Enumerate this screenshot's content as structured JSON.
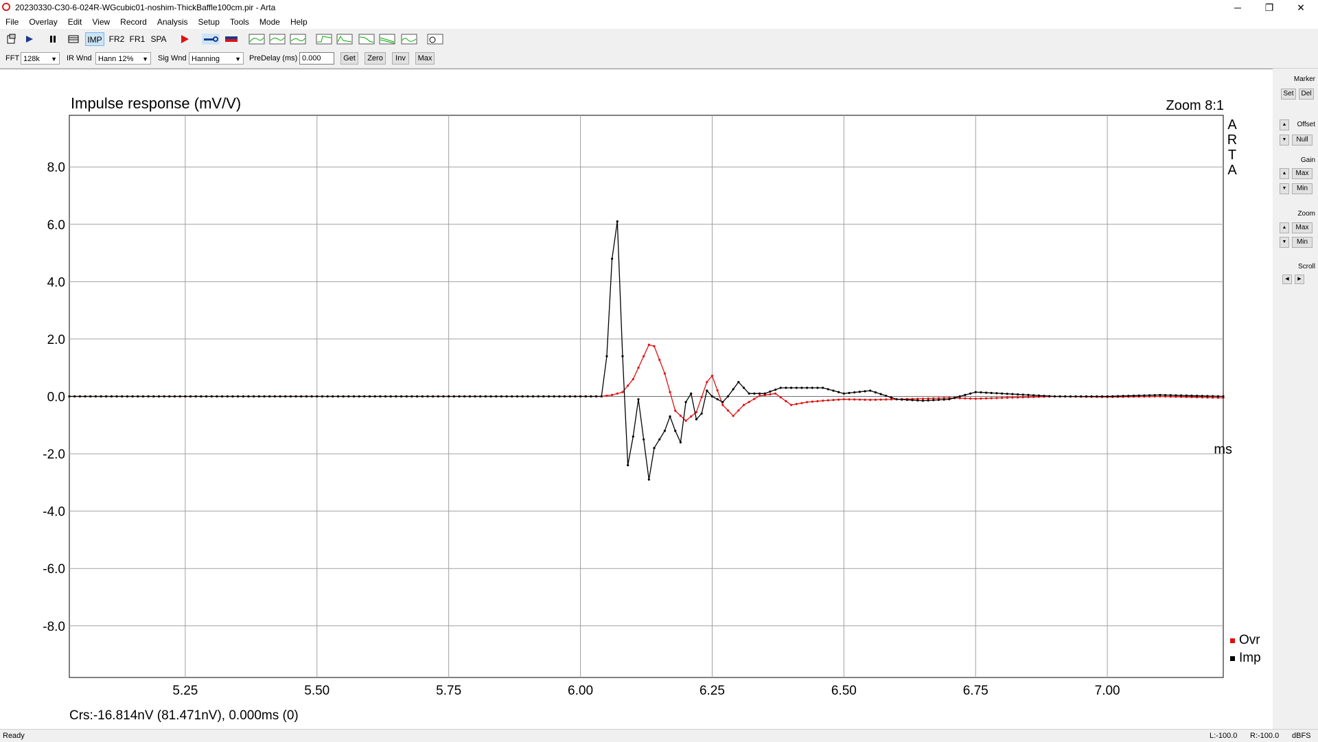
{
  "window": {
    "title": "20230330-C30-6-024R-WGcubic01-noshim-ThickBaffle100cm.pir - Arta",
    "minimize": "─",
    "restore": "❐",
    "close": "✕"
  },
  "menu": [
    "File",
    "Overlay",
    "Edit",
    "View",
    "Record",
    "Analysis",
    "Setup",
    "Tools",
    "Mode",
    "Help"
  ],
  "toolbar": {
    "mode_buttons": [
      "IMP",
      "FR2",
      "FR1",
      "SPA"
    ],
    "active_mode": "IMP",
    "analysis_icons": [
      "FR",
      "GFR",
      "SPLIT",
      "STEP",
      "ETC",
      "FREQ",
      "CSD",
      "BD",
      "STI"
    ]
  },
  "settings": {
    "fft_label": "FFT",
    "fft_value": "128k",
    "ir_wnd_label": "IR Wnd",
    "ir_wnd_value": "Hann 12%",
    "sig_wnd_label": "Sig Wnd",
    "sig_wnd_value": "Hanning",
    "predelay_label": "PreDelay (ms)",
    "predelay_value": "0.000",
    "get_label": "Get",
    "zero_label": "Zero",
    "inv_label": "Inv",
    "max_label": "Max"
  },
  "side_panel": {
    "marker_label": "Marker",
    "set_label": "Set",
    "del_label": "Del",
    "offset_label": "Offset",
    "null_label": "Null",
    "gain_label": "Gain",
    "gain_max": "Max",
    "gain_min": "Min",
    "zoom_label": "Zoom",
    "zoom_max": "Max",
    "zoom_min": "Min",
    "scroll_label": "Scroll"
  },
  "status": {
    "ready": "Ready",
    "left_level": "L:-100.0",
    "right_level": "R:-100.0",
    "units": "dBFS"
  },
  "chart_data": {
    "type": "line",
    "title": "Impulse response (mV/V)",
    "zoom_text": "Zoom 8:1",
    "brand": "ARTA",
    "xunit": "ms",
    "cursor_text": "Crs:-16.814nV (81.471nV), 0.000ms (0)",
    "xlim": [
      5.03,
      7.22
    ],
    "ylim": [
      -9.8,
      9.8
    ],
    "xticks": [
      5.25,
      5.5,
      5.75,
      6.0,
      6.25,
      6.5,
      6.75,
      7.0
    ],
    "xtick_labels": [
      "5.25",
      "5.50",
      "5.75",
      "6.00",
      "6.25",
      "6.50",
      "6.75",
      "7.00"
    ],
    "yticks": [
      8,
      6,
      4,
      2,
      0,
      -2,
      -4,
      -6,
      -8
    ],
    "ytick_labels": [
      "8.0",
      "6.0",
      "4.0",
      "2.0",
      "0.0",
      "-2.0",
      "-4.0",
      "-6.0",
      "-8.0"
    ],
    "grid": true,
    "legend_position": "bottom-right",
    "series": [
      {
        "name": "Ovr",
        "color": "#e01010",
        "x": [
          5.03,
          6.04,
          6.06,
          6.08,
          6.1,
          6.12,
          6.13,
          6.14,
          6.16,
          6.18,
          6.2,
          6.22,
          6.24,
          6.25,
          6.27,
          6.29,
          6.31,
          6.34,
          6.37,
          6.4,
          6.43,
          6.46,
          6.5,
          6.55,
          6.6,
          6.65,
          6.7,
          6.75,
          6.8,
          6.9,
          7.0,
          7.1,
          7.22
        ],
        "y": [
          0,
          0,
          0.05,
          0.15,
          0.6,
          1.4,
          1.8,
          1.75,
          0.8,
          -0.5,
          -0.85,
          -0.55,
          0.5,
          0.72,
          -0.3,
          -0.68,
          -0.3,
          0.02,
          0.1,
          -0.3,
          -0.2,
          -0.15,
          -0.1,
          -0.12,
          -0.1,
          -0.08,
          -0.05,
          -0.08,
          -0.05,
          0.0,
          -0.02,
          0.0,
          -0.05
        ]
      },
      {
        "name": "Imp",
        "color": "#000000",
        "x": [
          5.03,
          6.04,
          6.05,
          6.06,
          6.07,
          6.08,
          6.09,
          6.1,
          6.11,
          6.12,
          6.13,
          6.14,
          6.15,
          6.16,
          6.17,
          6.18,
          6.19,
          6.2,
          6.21,
          6.22,
          6.23,
          6.24,
          6.25,
          6.26,
          6.27,
          6.28,
          6.3,
          6.32,
          6.35,
          6.38,
          6.42,
          6.46,
          6.5,
          6.55,
          6.6,
          6.65,
          6.7,
          6.75,
          6.8,
          6.9,
          7.0,
          7.1,
          7.22
        ],
        "y": [
          0,
          0,
          1.4,
          4.8,
          6.1,
          1.4,
          -2.4,
          -1.4,
          -0.1,
          -1.5,
          -2.9,
          -1.8,
          -1.5,
          -1.2,
          -0.7,
          -1.2,
          -1.6,
          -0.2,
          0.1,
          -0.8,
          -0.6,
          0.2,
          0.0,
          -0.1,
          -0.2,
          0.0,
          0.5,
          0.1,
          0.1,
          0.3,
          0.3,
          0.3,
          0.1,
          0.2,
          -0.1,
          -0.15,
          -0.1,
          0.15,
          0.1,
          0.0,
          0.0,
          0.05,
          0.0
        ]
      }
    ]
  }
}
